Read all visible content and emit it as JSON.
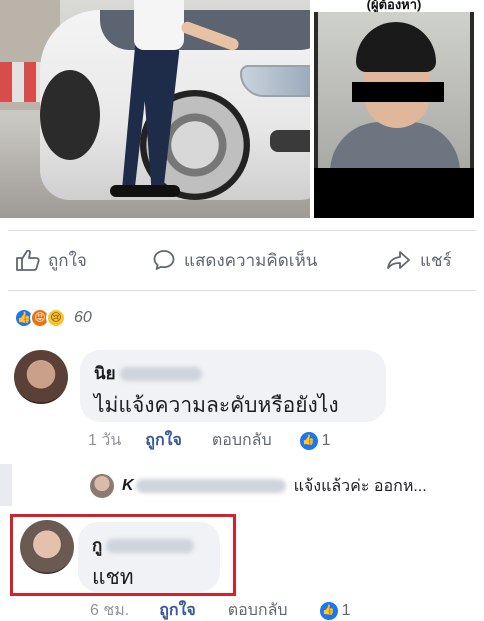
{
  "photos": {
    "side_caption": "(ผู้ต้องหา)"
  },
  "actions": {
    "like_label": "ถูกใจ",
    "comment_label": "แสดงความคิดเห็น",
    "share_label": "แชร์"
  },
  "reactions": {
    "types": [
      "like",
      "angry",
      "sad"
    ],
    "count": "60"
  },
  "comments": [
    {
      "author_visible": "นิย",
      "text": "ไม่แจ้งความละคับหรือยังไง",
      "time": "1 วัน",
      "like_label": "ถูกใจ",
      "reply_label": "ตอบกลับ",
      "like_count": "1",
      "reply_preview": {
        "author_visible": "K",
        "text": "แจ้งแล้วค่ะ ออกห..."
      }
    },
    {
      "author_visible": "กู",
      "text": "แชท",
      "time": "6 ชม.",
      "like_label": "ถูกใจ",
      "reply_label": "ตอบกลับ",
      "like_count": "1"
    }
  ],
  "colors": {
    "brand_blue": "#1877f2",
    "link_blue": "#385898",
    "highlight_red": "#d3222a",
    "bubble_bg": "#f0f2f5"
  }
}
